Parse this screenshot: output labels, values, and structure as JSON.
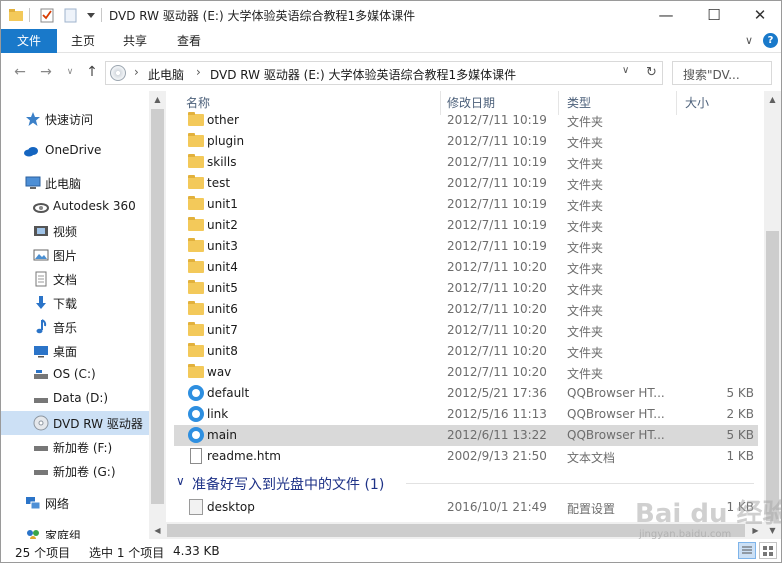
{
  "window": {
    "title": "DVD RW 驱动器 (E:) 大学体验英语综合教程1多媒体课件"
  },
  "ribbon": {
    "tabs": [
      {
        "label": "文件"
      },
      {
        "label": "主页"
      },
      {
        "label": "共享"
      },
      {
        "label": "查看"
      }
    ]
  },
  "address": {
    "crumbs": [
      "此电脑",
      "DVD RW 驱动器 (E:) 大学体验英语综合教程1多媒体课件"
    ],
    "search_placeholder": "搜索\"DV..."
  },
  "nav": {
    "items": [
      {
        "label": "快速访问",
        "icon": "star-icon"
      },
      {
        "label": "OneDrive",
        "icon": "cloud-icon"
      },
      {
        "label": "此电脑",
        "icon": "computer-icon"
      },
      {
        "label": "Autodesk 360",
        "icon": "autodesk-icon"
      },
      {
        "label": "视频",
        "icon": "video-icon"
      },
      {
        "label": "图片",
        "icon": "picture-icon"
      },
      {
        "label": "文档",
        "icon": "document-icon"
      },
      {
        "label": "下载",
        "icon": "download-icon"
      },
      {
        "label": "音乐",
        "icon": "music-icon"
      },
      {
        "label": "桌面",
        "icon": "desktop-icon"
      },
      {
        "label": "OS (C:)",
        "icon": "drive-icon"
      },
      {
        "label": "Data (D:)",
        "icon": "drive-icon"
      },
      {
        "label": "DVD RW 驱动器",
        "icon": "dvd-icon",
        "selected": true
      },
      {
        "label": "新加卷 (F:)",
        "icon": "drive-icon"
      },
      {
        "label": "新加卷 (G:)",
        "icon": "drive-icon"
      },
      {
        "label": "网络",
        "icon": "network-icon"
      },
      {
        "label": "家庭组",
        "icon": "homegroup-icon"
      }
    ]
  },
  "columns": {
    "name": "名称",
    "date": "修改日期",
    "type": "类型",
    "size": "大小"
  },
  "files": [
    {
      "name": "other",
      "date": "2012/7/11 10:19",
      "type": "文件夹",
      "size": "",
      "kind": "folder"
    },
    {
      "name": "plugin",
      "date": "2012/7/11 10:19",
      "type": "文件夹",
      "size": "",
      "kind": "folder"
    },
    {
      "name": "skills",
      "date": "2012/7/11 10:19",
      "type": "文件夹",
      "size": "",
      "kind": "folder"
    },
    {
      "name": "test",
      "date": "2012/7/11 10:19",
      "type": "文件夹",
      "size": "",
      "kind": "folder"
    },
    {
      "name": "unit1",
      "date": "2012/7/11 10:19",
      "type": "文件夹",
      "size": "",
      "kind": "folder"
    },
    {
      "name": "unit2",
      "date": "2012/7/11 10:19",
      "type": "文件夹",
      "size": "",
      "kind": "folder"
    },
    {
      "name": "unit3",
      "date": "2012/7/11 10:19",
      "type": "文件夹",
      "size": "",
      "kind": "folder"
    },
    {
      "name": "unit4",
      "date": "2012/7/11 10:20",
      "type": "文件夹",
      "size": "",
      "kind": "folder"
    },
    {
      "name": "unit5",
      "date": "2012/7/11 10:20",
      "type": "文件夹",
      "size": "",
      "kind": "folder"
    },
    {
      "name": "unit6",
      "date": "2012/7/11 10:20",
      "type": "文件夹",
      "size": "",
      "kind": "folder"
    },
    {
      "name": "unit7",
      "date": "2012/7/11 10:20",
      "type": "文件夹",
      "size": "",
      "kind": "folder"
    },
    {
      "name": "unit8",
      "date": "2012/7/11 10:20",
      "type": "文件夹",
      "size": "",
      "kind": "folder"
    },
    {
      "name": "wav",
      "date": "2012/7/11 10:20",
      "type": "文件夹",
      "size": "",
      "kind": "folder"
    },
    {
      "name": "default",
      "date": "2012/5/21 17:36",
      "type": "QQBrowser HT...",
      "size": "5 KB",
      "kind": "html"
    },
    {
      "name": "link",
      "date": "2012/5/16 11:13",
      "type": "QQBrowser HT...",
      "size": "2 KB",
      "kind": "html"
    },
    {
      "name": "main",
      "date": "2012/6/11 13:22",
      "type": "QQBrowser HT...",
      "size": "5 KB",
      "kind": "html",
      "selected": true
    },
    {
      "name": "readme.htm",
      "date": "2002/9/13 21:50",
      "type": "文本文档",
      "size": "1 KB",
      "kind": "text"
    }
  ],
  "group": {
    "label": "准备好写入到光盘中的文件 (1)"
  },
  "pending_files": [
    {
      "name": "desktop",
      "date": "2016/10/1 21:49",
      "type": "配置设置",
      "size": "1 KB",
      "kind": "config"
    }
  ],
  "status": {
    "count": "25 个项目",
    "selection": "选中 1 个项目",
    "size": "4.33 KB"
  },
  "watermark": {
    "text": "Bai du 经验",
    "sub": "jingyan.baidu.com"
  }
}
